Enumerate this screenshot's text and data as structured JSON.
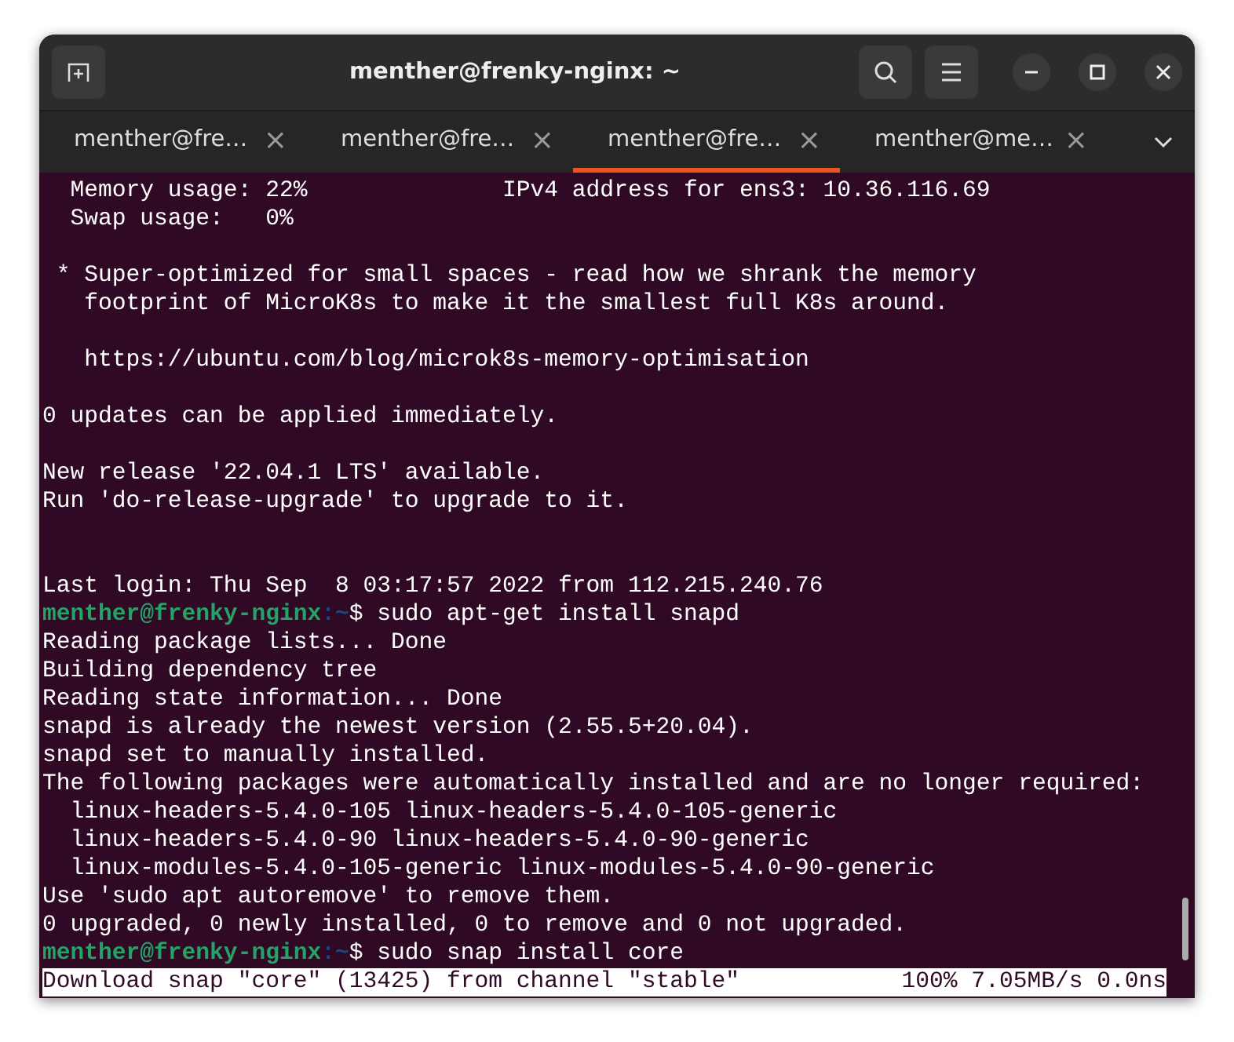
{
  "window": {
    "title": "menther@frenky-nginx: ~"
  },
  "tabs": [
    {
      "label": "menther@fre…",
      "close": "×",
      "selected": false
    },
    {
      "label": "menther@fre…",
      "close": "×",
      "selected": false
    },
    {
      "label": "menther@fre…",
      "close": "×",
      "selected": true
    },
    {
      "label": "menther@me…",
      "close": "×",
      "selected": false
    }
  ],
  "terminal": {
    "lines": [
      {
        "kind": "output",
        "text": "  Memory usage: 22%              IPv4 address for ens3: 10.36.116.69"
      },
      {
        "kind": "output",
        "text": "  Swap usage:   0%"
      },
      {
        "kind": "blank"
      },
      {
        "kind": "output",
        "text": " * Super-optimized for small spaces - read how we shrank the memory"
      },
      {
        "kind": "output",
        "text": "   footprint of MicroK8s to make it the smallest full K8s around."
      },
      {
        "kind": "blank"
      },
      {
        "kind": "output",
        "text": "   https://ubuntu.com/blog/microk8s-memory-optimisation"
      },
      {
        "kind": "blank"
      },
      {
        "kind": "output",
        "text": "0 updates can be applied immediately."
      },
      {
        "kind": "blank"
      },
      {
        "kind": "output",
        "text": "New release '22.04.1 LTS' available."
      },
      {
        "kind": "output",
        "text": "Run 'do-release-upgrade' to upgrade to it."
      },
      {
        "kind": "blank"
      },
      {
        "kind": "blank"
      },
      {
        "kind": "output",
        "text": "Last login: Thu Sep  8 03:17:57 2022 from 112.215.240.76"
      },
      {
        "kind": "prompt",
        "user": "menther@frenky-nginx",
        "path": ":~",
        "command": "$ sudo apt-get install snapd"
      },
      {
        "kind": "output",
        "text": "Reading package lists... Done"
      },
      {
        "kind": "output",
        "text": "Building dependency tree"
      },
      {
        "kind": "output",
        "text": "Reading state information... Done"
      },
      {
        "kind": "output",
        "text": "snapd is already the newest version (2.55.5+20.04)."
      },
      {
        "kind": "output",
        "text": "snapd set to manually installed."
      },
      {
        "kind": "output",
        "text": "The following packages were automatically installed and are no longer required:"
      },
      {
        "kind": "output",
        "text": "  linux-headers-5.4.0-105 linux-headers-5.4.0-105-generic"
      },
      {
        "kind": "output",
        "text": "  linux-headers-5.4.0-90 linux-headers-5.4.0-90-generic"
      },
      {
        "kind": "output",
        "text": "  linux-modules-5.4.0-105-generic linux-modules-5.4.0-90-generic"
      },
      {
        "kind": "output",
        "text": "Use 'sudo apt autoremove' to remove them."
      },
      {
        "kind": "output",
        "text": "0 upgraded, 0 newly installed, 0 to remove and 0 not upgraded."
      },
      {
        "kind": "prompt",
        "user": "menther@frenky-nginx",
        "path": ":~",
        "command": "$ sudo snap install core"
      },
      {
        "kind": "progress",
        "text": "Download snap \"core\" (13425) from channel \"stable\"",
        "status": "100% 7.05MB/s 0.0ns"
      }
    ]
  }
}
